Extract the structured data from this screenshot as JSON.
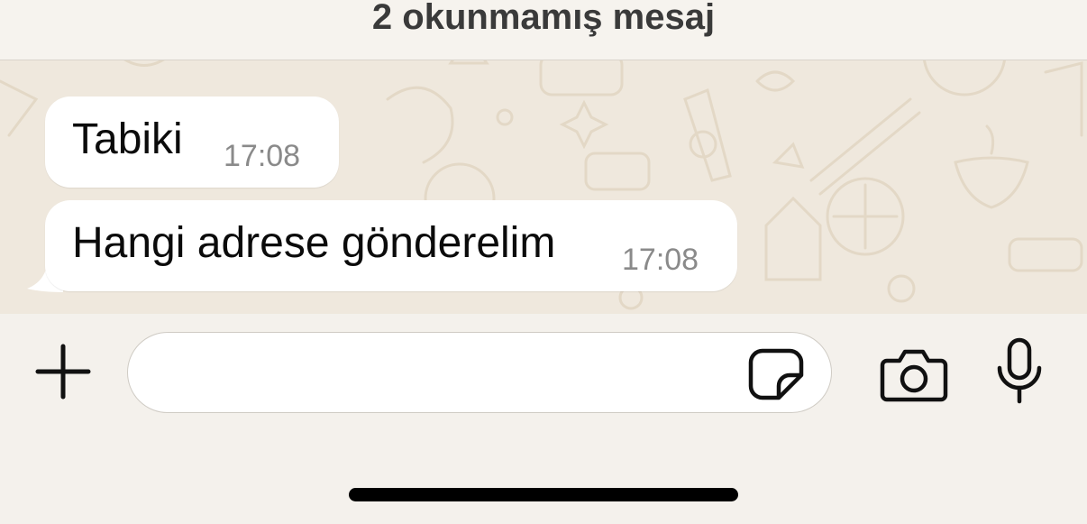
{
  "unread_banner": {
    "text": "2 okunmamış mesaj"
  },
  "messages": [
    {
      "text": "Tabiki",
      "time": "17:08",
      "direction": "incoming"
    },
    {
      "text": "Hangi adrese gönderelim",
      "time": "17:08",
      "direction": "incoming"
    }
  ],
  "composer": {
    "input_value": "",
    "icons": [
      "plus-icon",
      "sticker-icon",
      "camera-icon",
      "microphone-icon"
    ]
  },
  "colors": {
    "chat_background": "#efe8dd",
    "bubble": "#ffffff",
    "timestamp": "#8a8a8a",
    "composer_background": "#f4f1ec"
  }
}
